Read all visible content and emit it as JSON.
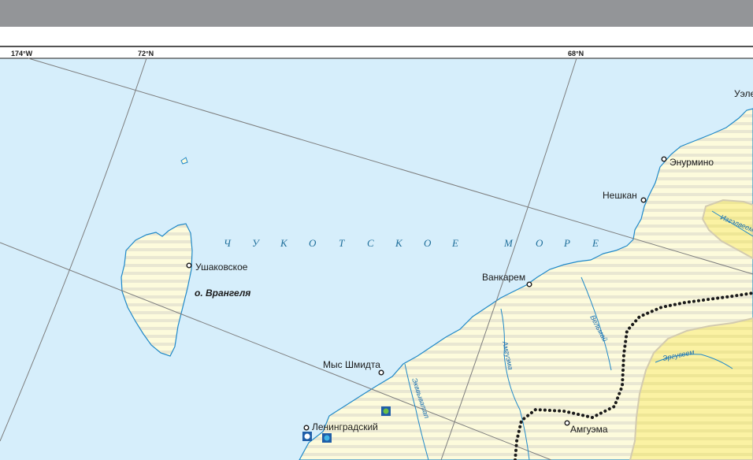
{
  "map": {
    "coordinates": {
      "lon_174w": "174°W",
      "lat_72n": "72°N",
      "lat_68n": "68°N"
    },
    "sea": {
      "letters": [
        "Ч",
        "У",
        "К",
        "О",
        "Т",
        "С",
        "К",
        "О",
        "Е",
        "М",
        "О",
        "Р",
        "Е"
      ]
    },
    "island": {
      "name": "о. Врангеля"
    },
    "places": {
      "ushakovskoe": "Ушаковское",
      "vankarem": "Ванкарем",
      "mys_shmidta": "Мыс Шмидта",
      "leningradsky": "Ленинградский",
      "amguema": "Амгуэма",
      "neshkan": "Нешкан",
      "enurmino": "Энурмино",
      "uelen_partial": "Уэле"
    },
    "rivers": {
      "amguema": "Амгуэма",
      "velmay": "Вельмай",
      "ekvyvatap": "Экввыватап",
      "ergyveem": "Эргувеем",
      "iskhlaveem": "Изгэлвеем"
    },
    "colors": {
      "sea": "#d6eefb",
      "land": "#fdfbdc",
      "land_stripe": "#d9d6ca",
      "highland": "#fbf2a3",
      "coast": "#1f88c8",
      "grid": "#7d7d7d",
      "header": "#939598"
    }
  }
}
